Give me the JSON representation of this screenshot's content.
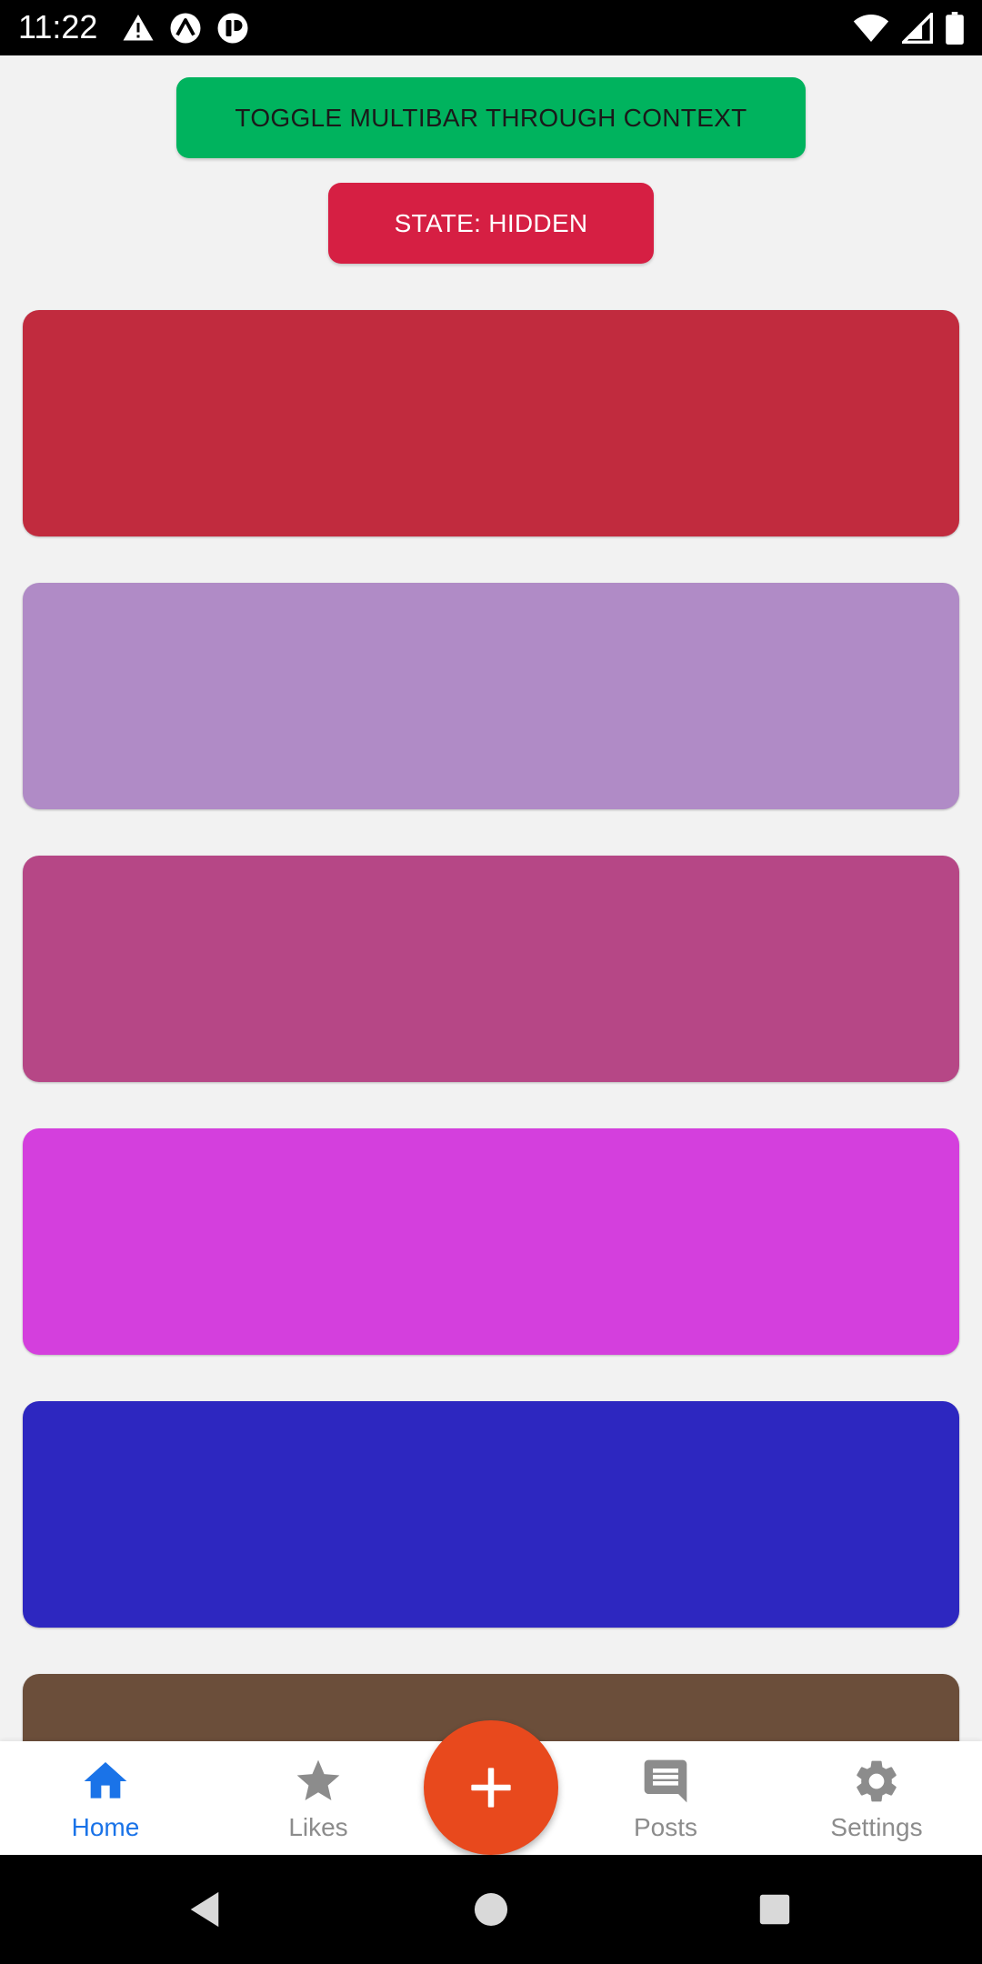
{
  "status_bar": {
    "time": "11:22",
    "icons": [
      "alert-triangle-icon",
      "expo-icon",
      "react-native-icon",
      "wifi-icon",
      "signal-icon",
      "battery-icon"
    ]
  },
  "actions": {
    "toggle_label": "Toggle multibar through context",
    "state_label": "State: hidden",
    "toggle_color": "#00b35e",
    "state_color": "#d61f43"
  },
  "cards": [
    {
      "color": "#c12b3e"
    },
    {
      "color": "#b08bc6"
    },
    {
      "color": "#b64786"
    },
    {
      "color": "#d43fdd"
    },
    {
      "color": "#2d27c0"
    },
    {
      "color": "#6b4e3a"
    }
  ],
  "tabbar": {
    "active_color": "#1a73e8",
    "inactive_color": "#8c8c8c",
    "tabs": [
      {
        "label": "Home",
        "icon": "home-icon",
        "active": true
      },
      {
        "label": "Likes",
        "icon": "star-icon",
        "active": false
      },
      {
        "label": "Posts",
        "icon": "chat-bubble-icon",
        "active": false
      },
      {
        "label": "Settings",
        "icon": "gear-icon",
        "active": false
      }
    ],
    "fab": {
      "icon": "plus-icon",
      "color": "#e8491d"
    }
  },
  "nav_bar": {
    "icons": [
      "back-triangle-icon",
      "home-circle-icon",
      "recents-square-icon"
    ]
  }
}
